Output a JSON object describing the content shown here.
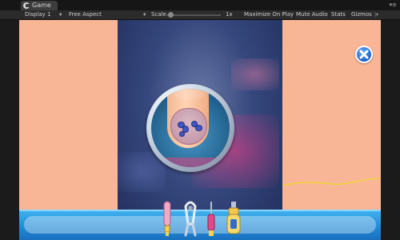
{
  "editor": {
    "tab_label": "Game",
    "toolbar": {
      "display": "Display 1",
      "aspect": "Free Aspect",
      "scale_label": "Scale",
      "scale_value": "1x",
      "maximize": "Maximize On Play",
      "mute": "Mute Audio",
      "stats": "Stats",
      "gizmos": "Gizmos"
    }
  },
  "game": {
    "colors": {
      "skin_background": "#f8b696",
      "center_panel": "#2a3a6e",
      "tray_blue": "#1f86d4",
      "close_button": "#1c63c8"
    },
    "close_button_icon": "close-icon",
    "tools": [
      {
        "name": "cuticle-pusher",
        "icon": "pink-pusher-icon"
      },
      {
        "name": "nail-clipper",
        "icon": "clipper-icon"
      },
      {
        "name": "nail-file",
        "icon": "file-icon"
      },
      {
        "name": "spray-bottle",
        "icon": "spray-icon"
      }
    ]
  }
}
